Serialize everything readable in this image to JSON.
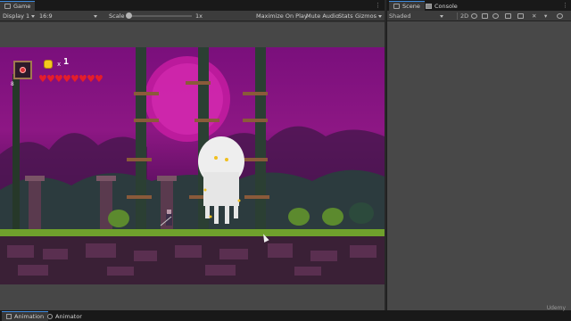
{
  "game_panel": {
    "tab_label": "Game",
    "toolbar": {
      "display": "Display 1",
      "aspect": "16:9",
      "scale_label": "Scale",
      "scale_value": "1x",
      "scale_fraction": 0.0,
      "maximize": "Maximize On Play",
      "mute": "Mute Audio",
      "stats": "Stats",
      "gizmos": "Gizmos"
    }
  },
  "hud": {
    "level": "8",
    "coin_multiplier": "x",
    "coin_count": "1",
    "hearts": 8
  },
  "scene_panel": {
    "tabs": [
      {
        "label": "Scene",
        "icon": "grid-icon"
      },
      {
        "label": "Console",
        "icon": "console-icon"
      }
    ],
    "shading_mode": "Shaded",
    "toolbar_icons": [
      "2d-toggle-icon",
      "lighting-icon",
      "audio-icon",
      "effects-icon",
      "hidden-objects-icon",
      "grid-icon",
      "tools-icon",
      "gizmos-icon",
      "search-icon"
    ]
  },
  "bottom_tabs": [
    {
      "label": "Animation",
      "icon": "animation-icon"
    },
    {
      "label": "Animator",
      "icon": "animator-icon"
    }
  ],
  "watermark": "Udemy",
  "colors": {
    "accent": "#3d8be0",
    "sky_magenta": "#8d1784",
    "heart_red": "#e41d2a",
    "coin_gold": "#f2c81f"
  }
}
